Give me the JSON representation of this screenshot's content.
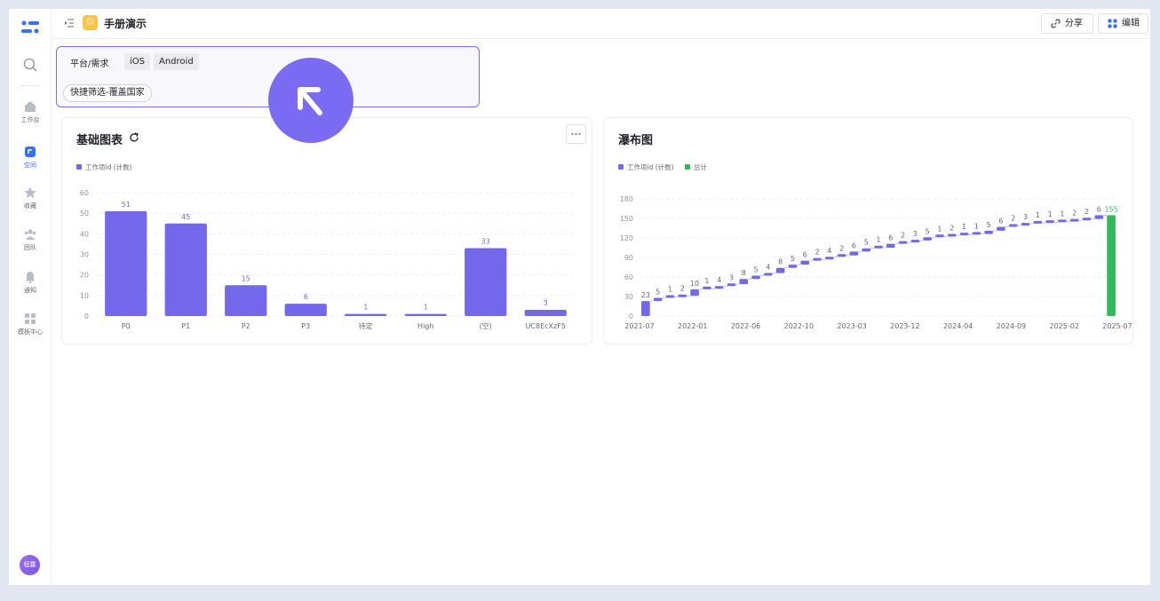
{
  "sidebar": {
    "items": [
      {
        "label": "工作台"
      },
      {
        "label": "空间"
      },
      {
        "label": "收藏"
      },
      {
        "label": "团队"
      },
      {
        "label": "通知"
      },
      {
        "label": "模板中心"
      }
    ],
    "active": "空间",
    "avatar": "程露"
  },
  "header": {
    "title": "手册演示",
    "share_label": "分享",
    "edit_label": "编辑"
  },
  "filter": {
    "label": "平台/需求",
    "tags": [
      "iOS",
      "Android"
    ],
    "quick_filter": "快捷筛选-覆盖国家"
  },
  "colors": {
    "accent": "#7367ec",
    "total": "#34b95a",
    "filter_border": "#7b6cf0",
    "cursor": "#7a6bf2"
  },
  "chart_data": [
    {
      "type": "bar",
      "title": "基础图表",
      "legend": [
        "工作项id (计数)"
      ],
      "categories": [
        "P0",
        "P1",
        "P2",
        "P3",
        "待定",
        "High",
        "(空)",
        "UC8EcXzF5"
      ],
      "values": [
        51,
        45,
        15,
        6,
        1,
        1,
        33,
        3
      ],
      "ylim": [
        0,
        60
      ],
      "yticks": [
        0,
        10,
        20,
        30,
        40,
        50,
        60
      ],
      "grid": true
    },
    {
      "type": "waterfall",
      "title": "瀑布图",
      "legend": [
        "工作项id (计数)",
        "总计"
      ],
      "steps": [
        23,
        5,
        1,
        2,
        10,
        1,
        4,
        3,
        8,
        5,
        4,
        8,
        5,
        6,
        2,
        4,
        2,
        6,
        5,
        1,
        6,
        2,
        3,
        5,
        1,
        2,
        1,
        1,
        5,
        6,
        2,
        3,
        1,
        1,
        1,
        2,
        2,
        6
      ],
      "total": 155,
      "xticks": [
        "2021-07",
        "2022-01",
        "2022-06",
        "2022-10",
        "2023-03",
        "2023-12",
        "2024-04",
        "2024-09",
        "2025-02",
        "2025-07"
      ],
      "ylim": [
        0,
        180
      ],
      "yticks": [
        0,
        30,
        60,
        90,
        120,
        150,
        180
      ],
      "grid": true
    }
  ]
}
